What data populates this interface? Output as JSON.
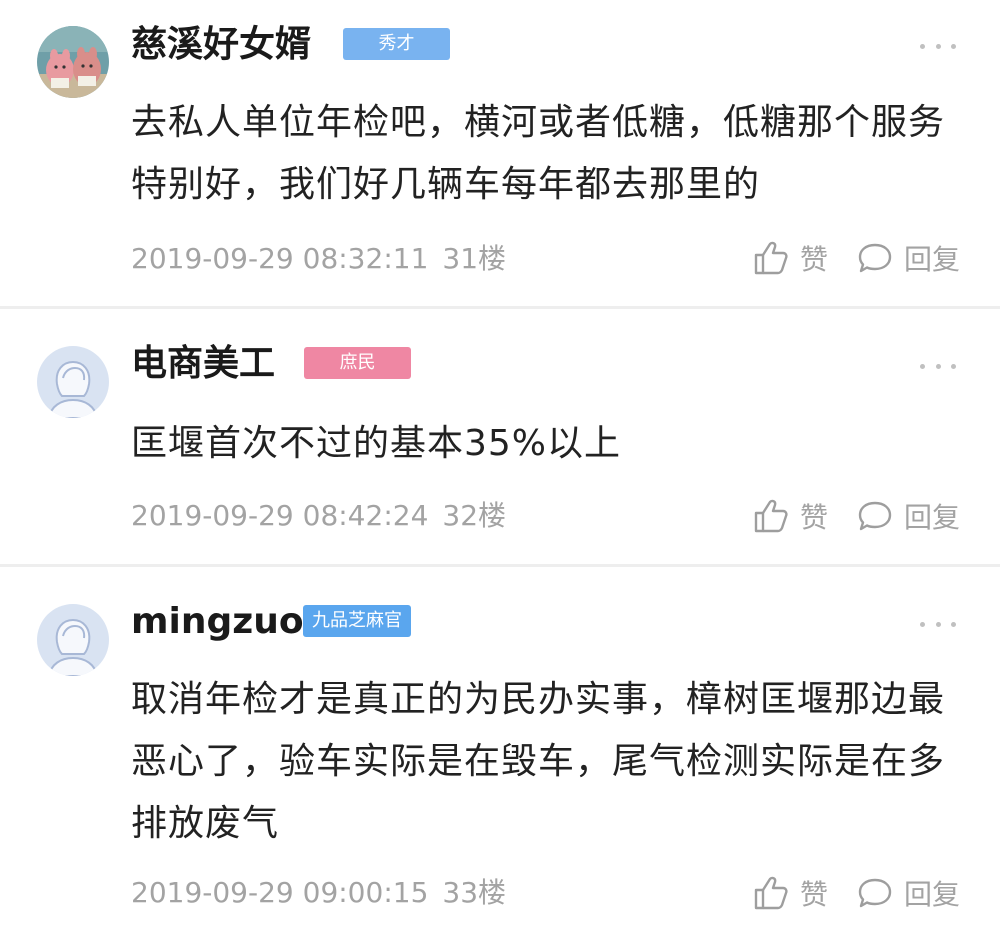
{
  "comments": [
    {
      "username": "慈溪好女婿",
      "badge": "秀才",
      "badge_color": "#79b3f0",
      "avatar_type": "photo",
      "content": "去私人单位年检吧，横河或者低糖，低糖那个服务特别好，我们好几辆车每年都去那里的",
      "timestamp": "2019-09-29 08:32:11",
      "floor": "31楼",
      "like_label": "赞",
      "reply_label": "回复"
    },
    {
      "username": "电商美工",
      "badge": "庶民",
      "badge_color": "#ef87a3",
      "avatar_type": "default",
      "content": "匡堰首次不过的基本35%以上",
      "timestamp": "2019-09-29 08:42:24",
      "floor": "32楼",
      "like_label": "赞",
      "reply_label": "回复"
    },
    {
      "username": "mingzuo",
      "badge": "九品芝麻官",
      "badge_color": "#5aa6ee",
      "avatar_type": "default",
      "content": "取消年检才是真正的为民办实事，樟树匡堰那边最恶心了，验车实际是在毁车，尾气检测实际是在多排放废气",
      "timestamp": "2019-09-29 09:00:15",
      "floor": "33楼",
      "like_label": "赞",
      "reply_label": "回复"
    }
  ],
  "icons": {
    "more": "more-dots-icon",
    "like": "thumbs-up-icon",
    "reply": "speech-bubble-icon"
  }
}
